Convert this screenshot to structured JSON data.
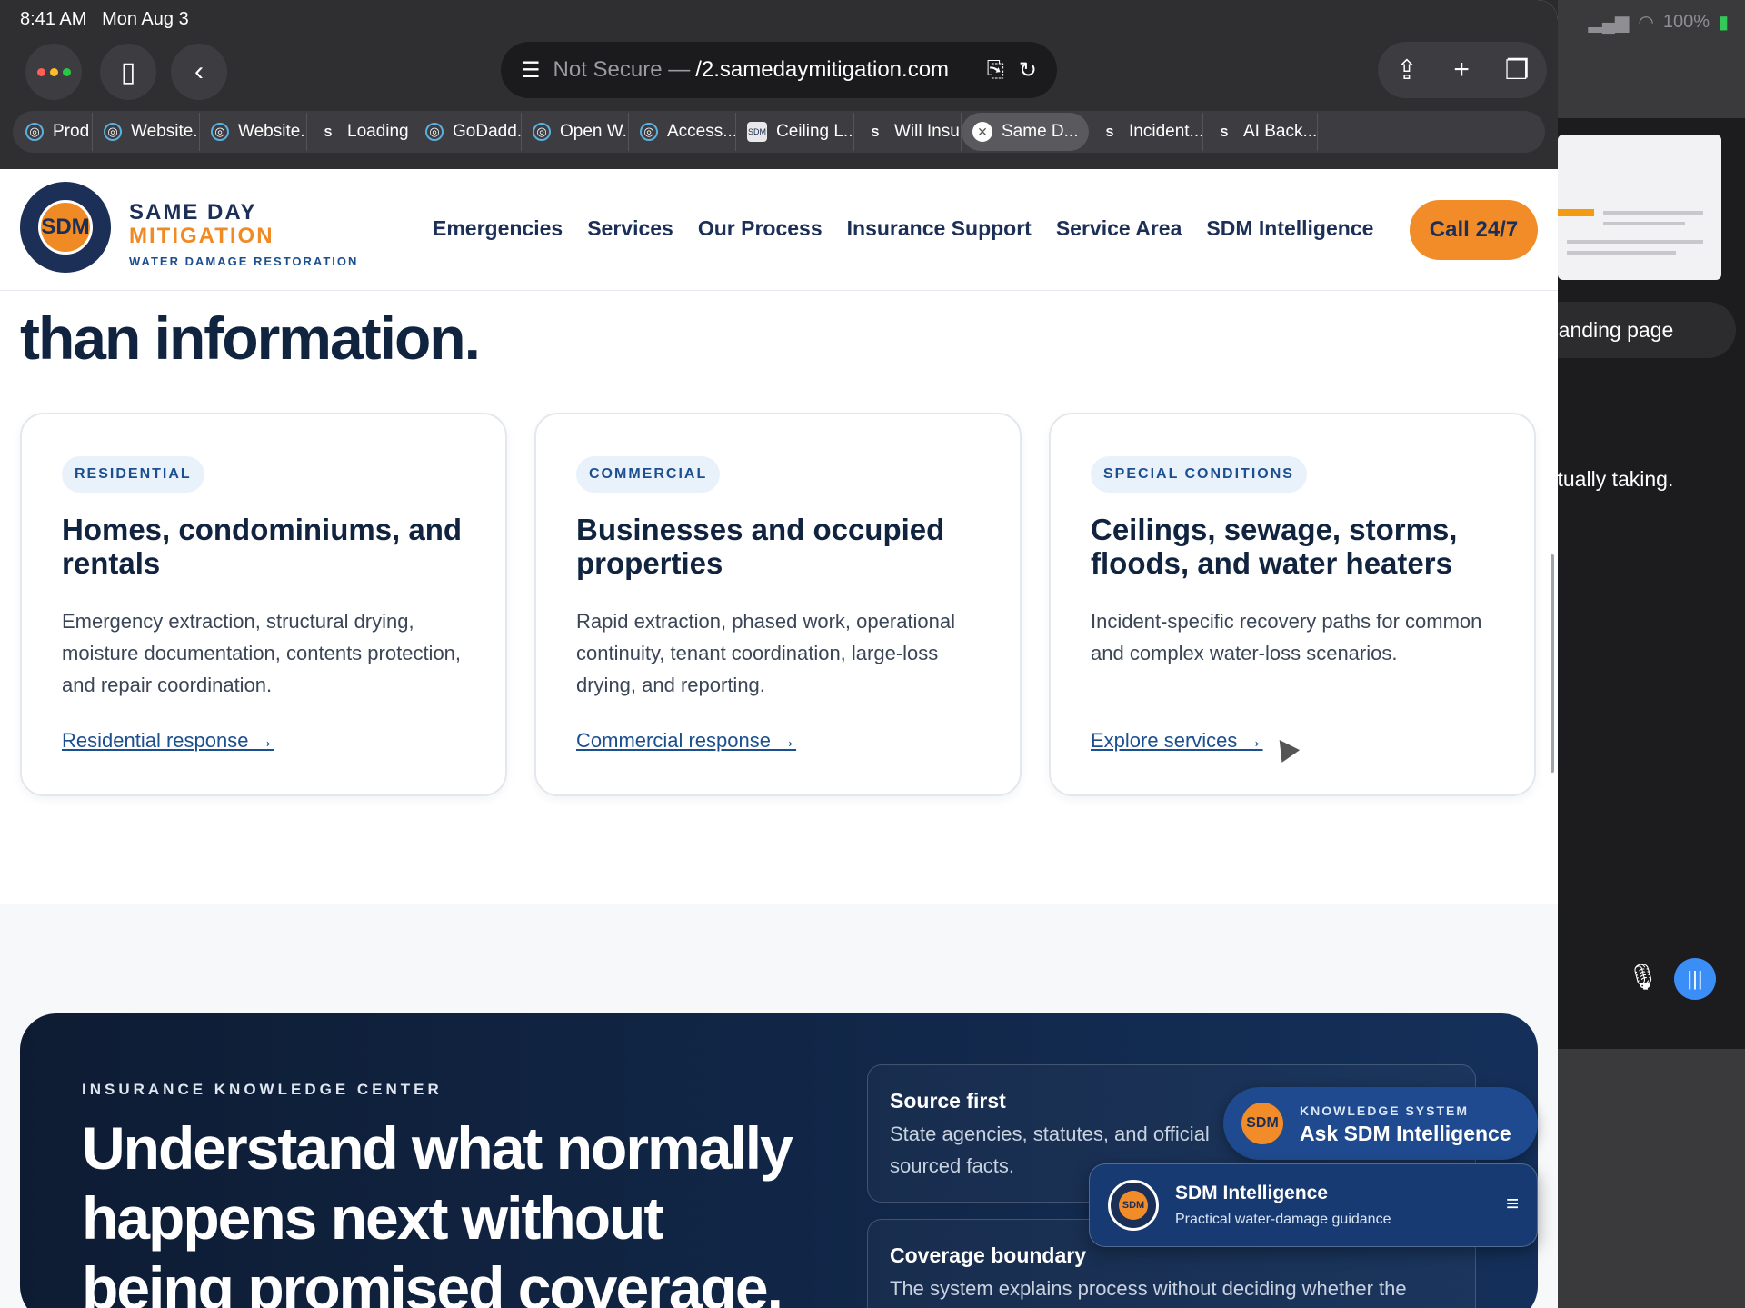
{
  "status_bar": {
    "time": "8:41 AM",
    "date": "Mon Aug 3",
    "battery": "100%"
  },
  "browser": {
    "url_prefix": "Not Secure —",
    "url_domain": "/2.samedaymitigation.com",
    "tabs": [
      {
        "label": "Prod",
        "icon": "spiral-icon",
        "active": false
      },
      {
        "label": "Website...",
        "icon": "spiral-icon",
        "active": false
      },
      {
        "label": "Website...",
        "icon": "spiral-icon",
        "active": false
      },
      {
        "label": "Loading",
        "icon": "s-letter-icon",
        "active": false
      },
      {
        "label": "GoDadd...",
        "icon": "spiral-icon",
        "active": false
      },
      {
        "label": "Open W...",
        "icon": "spiral-icon",
        "active": false
      },
      {
        "label": "Access...",
        "icon": "spiral-icon",
        "active": false
      },
      {
        "label": "Ceiling L...",
        "icon": "sdm-logo-icon",
        "active": false
      },
      {
        "label": "Will Insu...",
        "icon": "s-letter-icon",
        "active": false
      },
      {
        "label": "Same D...",
        "icon": "close-icon",
        "active": true
      },
      {
        "label": "Incident...",
        "icon": "s-letter-icon",
        "active": false
      },
      {
        "label": "AI Back...",
        "icon": "s-letter-icon",
        "active": false
      }
    ]
  },
  "side_panel": {
    "pill_text": "nt landing page",
    "text": "ctually taking."
  },
  "site": {
    "logo_text": "SDM",
    "brand_line1": "SAME DAY",
    "brand_line2": "MITIGATION",
    "brand_line3": "WATER DAMAGE RESTORATION",
    "nav": [
      "Emergencies",
      "Services",
      "Our Process",
      "Insurance Support",
      "Service Area",
      "SDM Intelligence"
    ],
    "call_label": "Call 24/7",
    "partial_heading": "than information."
  },
  "cards": [
    {
      "tag": "RESIDENTIAL",
      "title": "Homes, condominiums, and rentals",
      "body": "Emergency extraction, structural drying, moisture documentation, contents protection, and repair coordination.",
      "link": "Residential response →"
    },
    {
      "tag": "COMMERCIAL",
      "title": "Businesses and occupied properties",
      "body": "Rapid extraction, phased work, operational continuity, tenant coordination, large-loss drying, and reporting.",
      "link": "Commercial response →"
    },
    {
      "tag": "SPECIAL CONDITIONS",
      "title": "Ceilings, sewage, storms, floods, and water heaters",
      "body": "Incident-specific recovery paths for common and complex water-loss scenarios.",
      "link": "Explore services →"
    }
  ],
  "insurance": {
    "eyebrow": "INSURANCE KNOWLEDGE CENTER",
    "heading": "Understand what normally happens next without being promised coverage.",
    "facts": [
      {
        "title": "Source first",
        "body": "State agencies, statutes, and official sourced facts."
      },
      {
        "title": "Coverage boundary",
        "body": "The system explains process without deciding whether the"
      }
    ]
  },
  "assistant": {
    "avatar": "SDM",
    "kicker": "KNOWLEDGE SYSTEM",
    "ask_label": "Ask SDM Intelligence",
    "panel_title": "SDM Intelligence",
    "panel_subtitle": "Practical water-damage guidance"
  }
}
